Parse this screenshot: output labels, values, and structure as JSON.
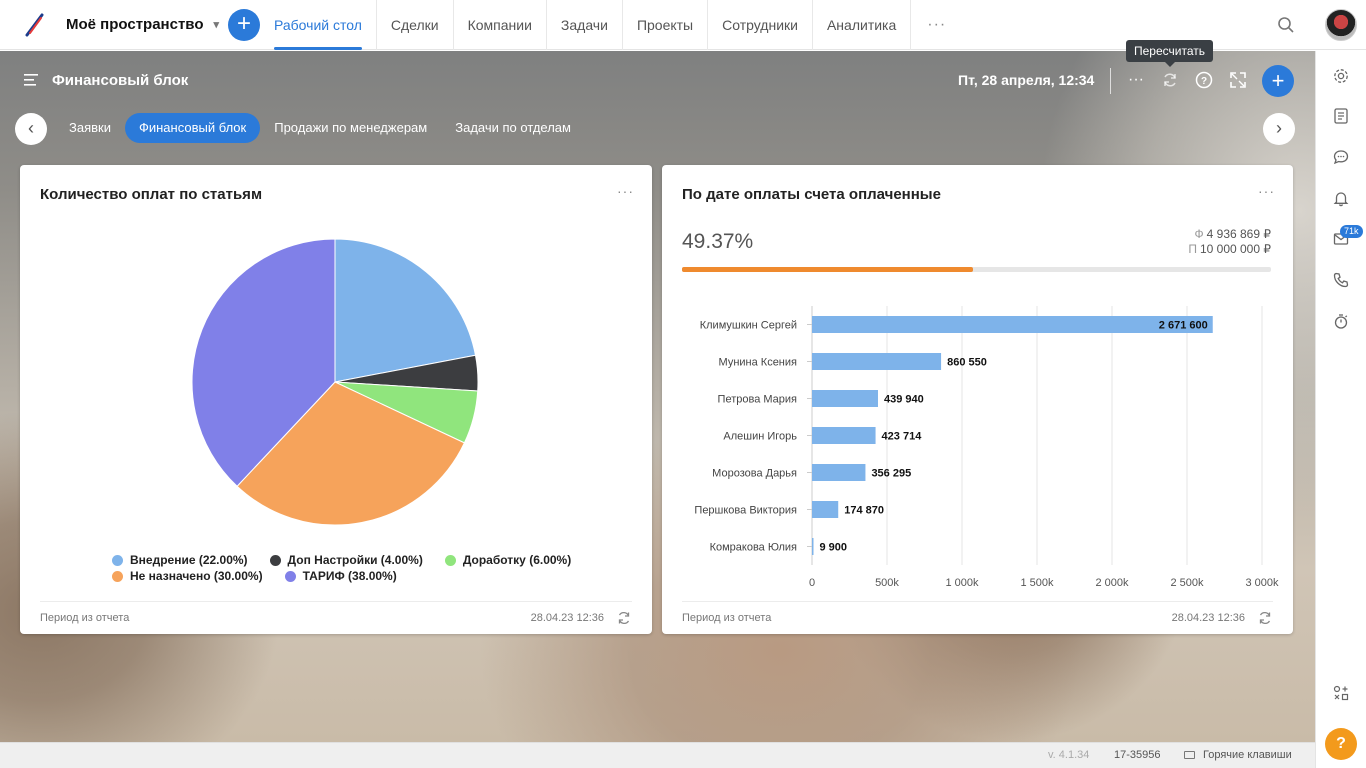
{
  "header": {
    "workspace": "Моё пространство",
    "nav_tabs": [
      "Рабочий стол",
      "Сделки",
      "Компании",
      "Задачи",
      "Проекты",
      "Сотрудники",
      "Аналитика"
    ],
    "active_tab": "Рабочий стол",
    "more": "···"
  },
  "dashboard": {
    "title": "Финансовый блок",
    "date": "Пт, 28 апреля, 12:34",
    "tooltip": "Пересчитать",
    "tabs": [
      "Заявки",
      "Финансовый блок",
      "Продажи по менеджерам",
      "Задачи по отделам"
    ],
    "active_tab": "Финансовый блок"
  },
  "pie_card": {
    "title": "Количество оплат по статьям",
    "more": "···",
    "footer_left": "Период из отчета",
    "footer_right": "28.04.23 12:36",
    "legend": [
      {
        "label": "Внедрение (22.00%)",
        "color": "#7eb3ea"
      },
      {
        "label": "Доп Настройки (4.00%)",
        "color": "#3c3d40"
      },
      {
        "label": "Доработку (6.00%)",
        "color": "#90e57d"
      },
      {
        "label": "Не назначено (30.00%)",
        "color": "#f6a35b"
      },
      {
        "label": "ТАРИФ (38.00%)",
        "color": "#8080e8"
      }
    ]
  },
  "bar_card": {
    "title": "По дате оплаты счета оплаченные",
    "more": "···",
    "percent_text": "49.37%",
    "progress": 0.4937,
    "fact_label": "Ф",
    "fact_value": "4 936 869 ₽",
    "plan_label": "П",
    "plan_value": "10 000 000 ₽",
    "footer_left": "Период из отчета",
    "footer_right": "28.04.23 12:36"
  },
  "chart_data": [
    {
      "type": "pie",
      "title": "Количество оплат по статьям",
      "labels": [
        "Внедрение",
        "Доп Настройки",
        "Доработку",
        "Не назначено",
        "ТАРИФ"
      ],
      "values": [
        22,
        4,
        6,
        30,
        38
      ],
      "colors": [
        "#7eb3ea",
        "#3c3d40",
        "#90e57d",
        "#f6a35b",
        "#8080e8"
      ],
      "legend": "bottom"
    },
    {
      "type": "bar",
      "orientation": "horizontal",
      "title": "По дате оплаты счета оплаченные",
      "categories": [
        "Климушкин Сергей",
        "Мунина Ксения",
        "Петрова Мария",
        "Алешин Игорь",
        "Морозова Дарья",
        "Першкова Виктория",
        "Комракова Юлия"
      ],
      "values": [
        2671600,
        860550,
        439940,
        423714,
        356295,
        174870,
        9900
      ],
      "value_labels": [
        "2 671 600",
        "860 550",
        "439 940",
        "423 714",
        "356 295",
        "174 870",
        "9 900"
      ],
      "xticks": [
        "0",
        "500k",
        "1 000k",
        "1 500k",
        "2 000k",
        "2 500k",
        "3 000k"
      ],
      "xlim": [
        0,
        3000000
      ],
      "color": "#7eb3ea",
      "grid": true
    }
  ],
  "footer": {
    "version": "v. 4.1.34",
    "build": "17-35956",
    "hotkeys": "Горячие клавиши"
  },
  "sidebar": {
    "badge": "71k",
    "help": "?"
  }
}
